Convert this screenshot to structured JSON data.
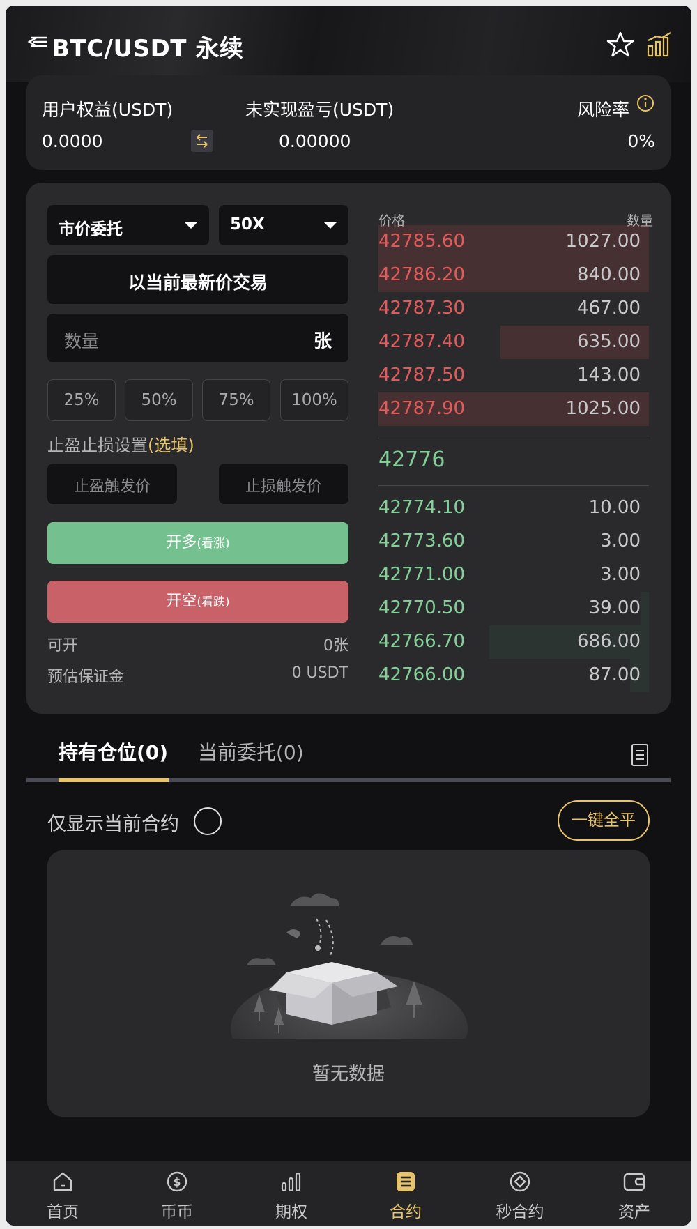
{
  "header": {
    "title": "BTC/USDT 永续"
  },
  "account": {
    "equity_label": "用户权益(USDT)",
    "equity_value": "0.0000",
    "unrealized_label": "未实现盈亏(USDT)",
    "unrealized_value": "0.00000",
    "risk_label": "风险率",
    "risk_value": "0%"
  },
  "order_form": {
    "order_type": "市价委托",
    "leverage": "50X",
    "price_mode": "以当前最新价交易",
    "quantity_placeholder": "数量",
    "quantity_unit": "张",
    "percent_options": [
      "25%",
      "50%",
      "75%",
      "100%"
    ],
    "tpsl_label": "止盈止损设置",
    "tpsl_optional": "(选填)",
    "take_profit_placeholder": "止盈触发价",
    "stop_loss_placeholder": "止损触发价",
    "long_label": "开多",
    "long_hint": "(看涨)",
    "short_label": "开空",
    "short_hint": "(看跌)",
    "available_label": "可开",
    "available_value": "0张",
    "margin_label": "预估保证金",
    "margin_value": "0 USDT"
  },
  "orderbook": {
    "price_header": "价格",
    "qty_header": "数量",
    "asks": [
      {
        "price": "42785.60",
        "qty": "1027.00",
        "depth": 1.0
      },
      {
        "price": "42786.20",
        "qty": "840.00",
        "depth": 1.0
      },
      {
        "price": "42787.30",
        "qty": "467.00",
        "depth": 0.0
      },
      {
        "price": "42787.40",
        "qty": "635.00",
        "depth": 0.55
      },
      {
        "price": "42787.50",
        "qty": "143.00",
        "depth": 0.0
      },
      {
        "price": "42787.90",
        "qty": "1025.00",
        "depth": 1.0
      }
    ],
    "last_price": "42776",
    "bids": [
      {
        "price": "42774.10",
        "qty": "10.00",
        "depth": 0.0
      },
      {
        "price": "42773.60",
        "qty": "3.00",
        "depth": 0.0
      },
      {
        "price": "42771.00",
        "qty": "3.00",
        "depth": 0.0
      },
      {
        "price": "42770.50",
        "qty": "39.00",
        "depth": 0.03
      },
      {
        "price": "42766.70",
        "qty": "686.00",
        "depth": 0.59
      },
      {
        "price": "42766.00",
        "qty": "87.00",
        "depth": 0.07
      }
    ]
  },
  "positions": {
    "tab_positions": "持有仓位(0)",
    "tab_orders": "当前委托(0)",
    "filter_label": "仅显示当前合约",
    "close_all_label": "一键全平",
    "empty_text": "暂无数据"
  },
  "nav": {
    "items": [
      {
        "label": "首页",
        "icon": "home-icon"
      },
      {
        "label": "币币",
        "icon": "coin-icon"
      },
      {
        "label": "期权",
        "icon": "bar-chart-icon"
      },
      {
        "label": "合约",
        "icon": "contract-icon"
      },
      {
        "label": "秒合约",
        "icon": "diamond-icon"
      },
      {
        "label": "资产",
        "icon": "wallet-icon"
      }
    ],
    "active_index": 3
  },
  "colors": {
    "accent": "#e7c36b",
    "long": "#75c08f",
    "short": "#c96169",
    "ask_text": "#e35a5a",
    "bid_text": "#82cf98"
  }
}
